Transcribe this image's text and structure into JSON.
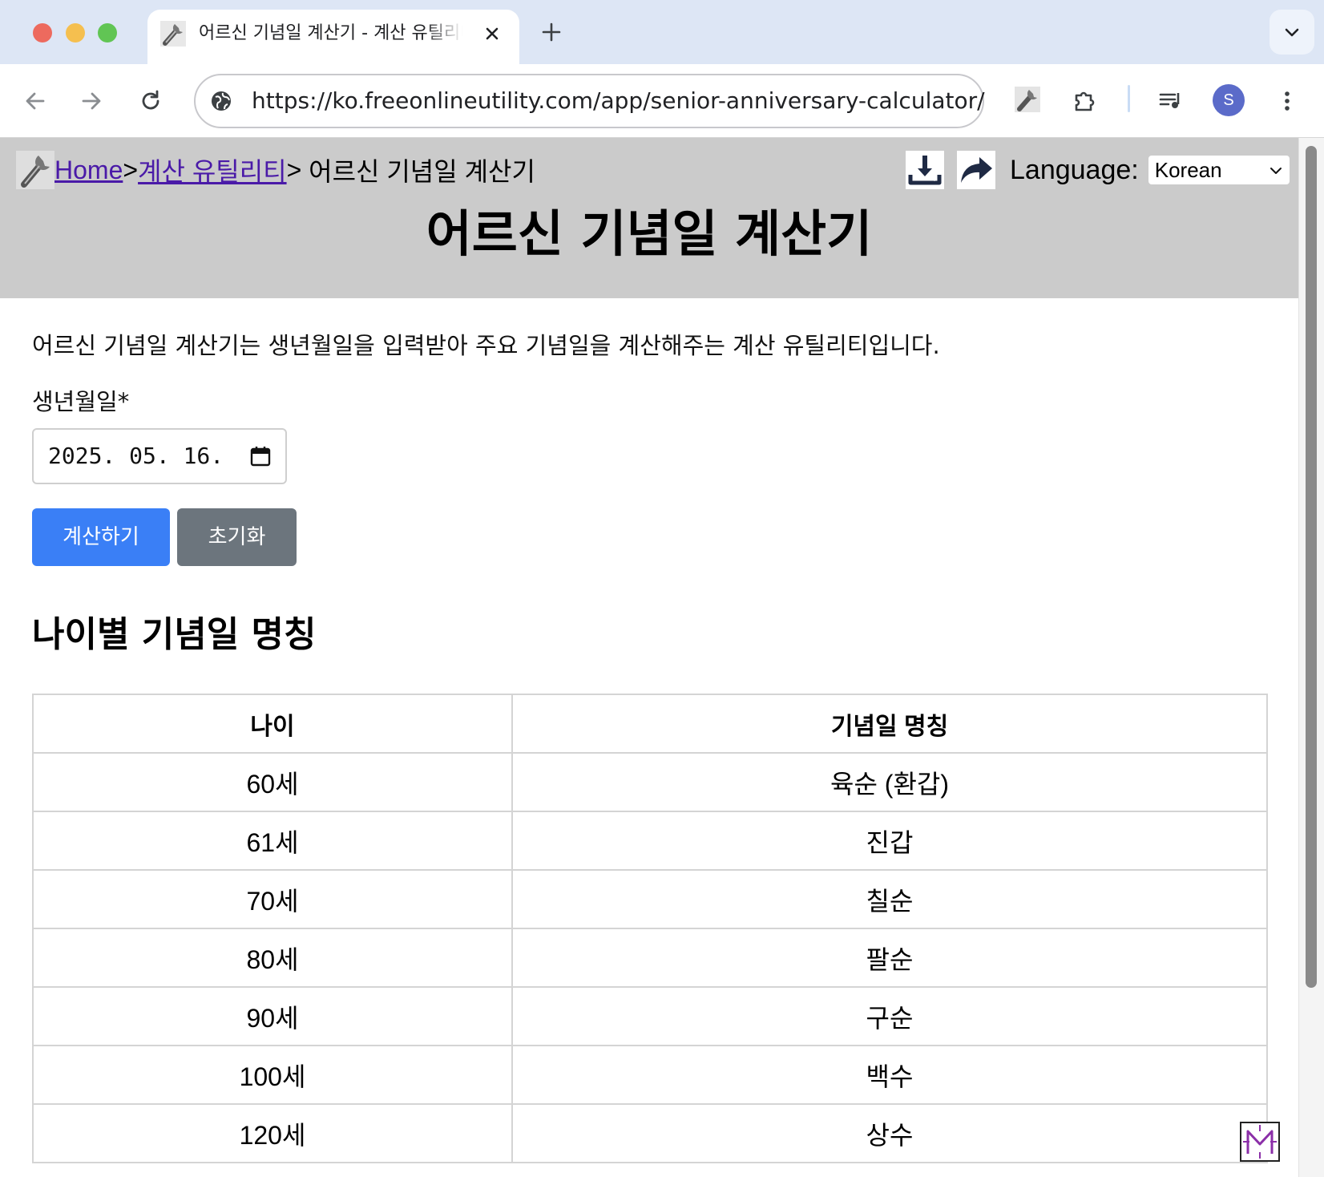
{
  "browser": {
    "tab_title": "어르신 기념일 계산기 - 계산 유틸리티",
    "url": "https://ko.freeonlineutility.com/app/senior-anniversary-calculator/",
    "profile_initial": "S",
    "icons": [
      "back-icon",
      "forward-icon",
      "reload-icon",
      "globe-icon",
      "extensions-icon",
      "media-icon",
      "more-icon",
      "tab-close-icon",
      "new-tab-icon",
      "tab-search-icon"
    ]
  },
  "header": {
    "breadcrumb": {
      "home": "Home",
      "sep1": ">",
      "category": "계산 유틸리티",
      "sep2": ">",
      "current": " 어르신 기념일 계산기"
    },
    "language_label": "Language:",
    "language_value": "Korean",
    "title": "어르신 기념일 계산기"
  },
  "main": {
    "description": "어르신 기념일 계산기는 생년월일을 입력받아 주요 기념일을 계산해주는 계산 유틸리티입니다.",
    "birthdate_label": "생년월일*",
    "birthdate_value": "2025. 05. 16.",
    "calculate_button": "계산하기",
    "reset_button": "초기화",
    "section_title": "나이별 기념일 명칭",
    "table": {
      "headers": [
        "나이",
        "기념일 명칭"
      ],
      "rows": [
        [
          "60세",
          "육순 (환갑)"
        ],
        [
          "61세",
          "진갑"
        ],
        [
          "70세",
          "칠순"
        ],
        [
          "80세",
          "팔순"
        ],
        [
          "90세",
          "구순"
        ],
        [
          "100세",
          "백수"
        ],
        [
          "120세",
          "상수"
        ]
      ]
    }
  },
  "colors": {
    "header_bg": "#cbcbcb",
    "primary_button": "#3a7ff6",
    "secondary_button": "#6c757d",
    "link": "#4a1aa8",
    "tabbar_bg": "#dde6f5"
  }
}
